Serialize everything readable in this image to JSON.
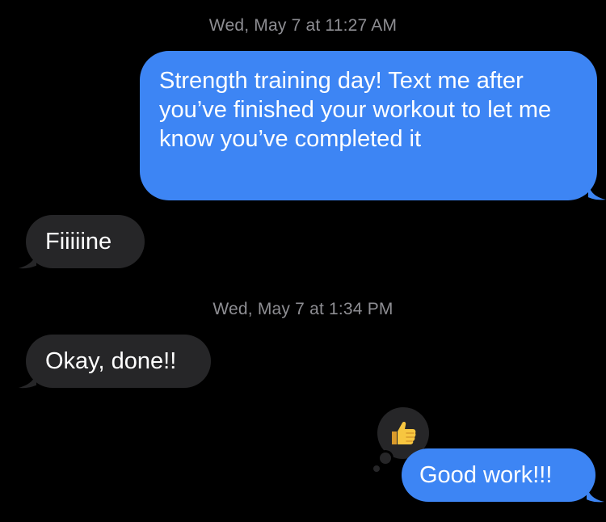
{
  "thread": {
    "timestamps": [
      "Wed, May 7 at 11:27 AM",
      "Wed, May 7 at 1:34 PM"
    ],
    "messages": [
      {
        "direction": "sent",
        "text": "Strength training day! Text me after you’ve finished your workout to let me know you’ve completed it"
      },
      {
        "direction": "received",
        "text": "Fiiiiine"
      },
      {
        "direction": "received",
        "text": "Okay, done!!"
      },
      {
        "direction": "sent",
        "text": "Good work!!!"
      }
    ],
    "tapback": {
      "icon": "thumbs-up-icon",
      "on_message": "Okay, done!!"
    }
  },
  "colors": {
    "background": "#000000",
    "sent_bubble": "#3d85f4",
    "received_bubble": "#262628",
    "timestamp_text": "#8e8e93",
    "message_text": "#ffffff"
  }
}
